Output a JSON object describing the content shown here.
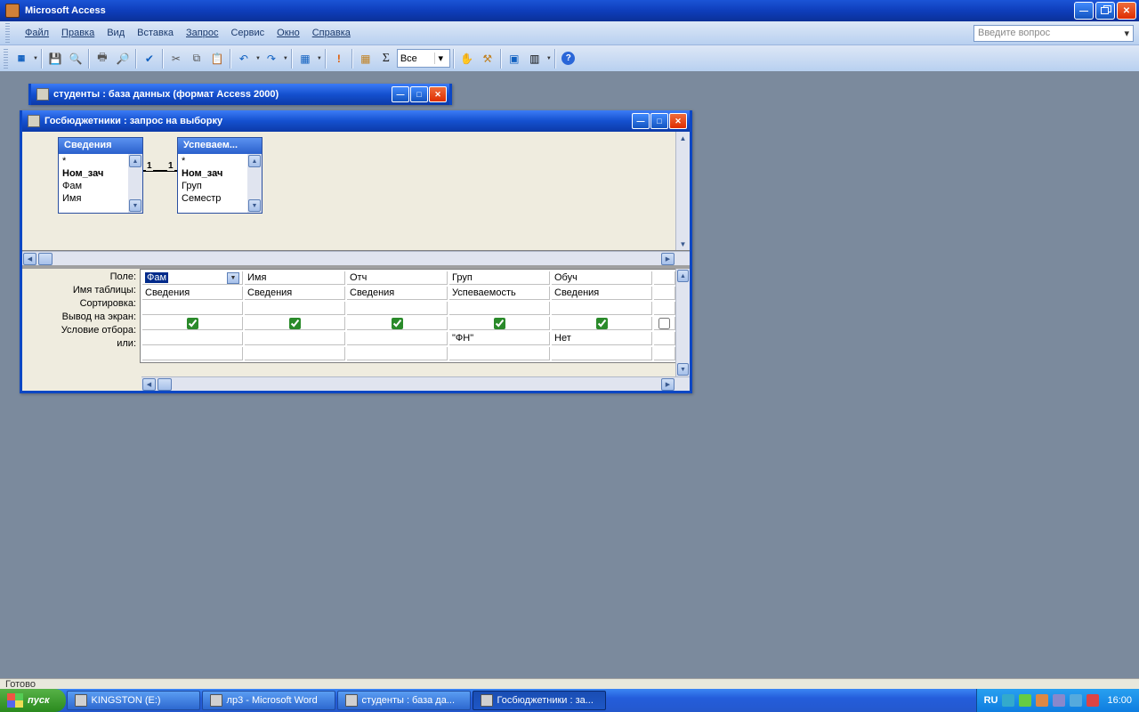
{
  "app_title": "Microsoft Access",
  "menu": [
    "Файл",
    "Правка",
    "Вид",
    "Вставка",
    "Запрос",
    "Сервис",
    "Окно",
    "Справка"
  ],
  "help_placeholder": "Введите вопрос",
  "toolbar_combo": "Все",
  "db_window_title": "студенты : база данных (формат Access 2000)",
  "query_window_title": "Госбюджетники : запрос на выборку",
  "tables": {
    "t1": {
      "name": "Сведения",
      "fields": [
        "*",
        "Ном_зач",
        "Фам",
        "Имя"
      ],
      "bold_idx": 1
    },
    "t2": {
      "name": "Успеваем...",
      "fields": [
        "*",
        "Ном_зач",
        "Груп",
        "Семестр"
      ],
      "bold_idx": 1
    }
  },
  "relation": {
    "left": "1",
    "right": "1"
  },
  "grid_labels": [
    "Поле:",
    "Имя таблицы:",
    "Сортировка:",
    "Вывод на экран:",
    "Условие отбора:",
    "или:"
  ],
  "grid": {
    "field": [
      "Фам",
      "Имя",
      "Отч",
      "Груп",
      "Обуч"
    ],
    "table": [
      "Сведения",
      "Сведения",
      "Сведения",
      "Успеваемость",
      "Сведения"
    ],
    "sort": [
      "",
      "",
      "",
      "",
      ""
    ],
    "show": [
      true,
      true,
      true,
      true,
      true
    ],
    "criteria": [
      "",
      "",
      "",
      "\"ФН\"",
      "Нет"
    ],
    "or": [
      "",
      "",
      "",
      "",
      ""
    ]
  },
  "status": "Готово",
  "start_label": "пуск",
  "taskbar": [
    {
      "label": "KINGSTON (E:)",
      "active": false
    },
    {
      "label": "лр3 - Microsoft Word",
      "active": false
    },
    {
      "label": "студенты : база да...",
      "active": false
    },
    {
      "label": "Госбюджетники : за...",
      "active": true
    }
  ],
  "lang": "RU",
  "clock": "16:00"
}
